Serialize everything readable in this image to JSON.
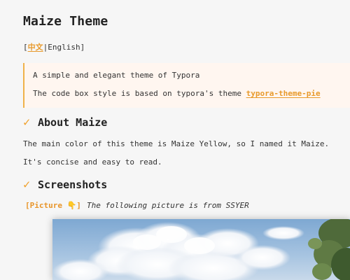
{
  "doc": {
    "title": "Maize Theme",
    "lang_open": "[",
    "lang_zh": "中文",
    "lang_sep": "|",
    "lang_en": "English",
    "lang_close": "]",
    "quote": {
      "line1": "A simple and elegant theme of Typora",
      "line2_prefix": "The code box style is based on typora's theme ",
      "line2_link": "typora-theme-pie"
    },
    "about": {
      "heading": "About Maize",
      "p1": "The main color of this theme is Maize Yellow, so I named it Maize.",
      "p2": "It's concise and easy to read."
    },
    "screenshots": {
      "heading": "Screenshots",
      "picture_tag": "[Picture 👇]",
      "caption": "The following picture is from SSYER"
    }
  },
  "colors": {
    "accent": "#e89a2c",
    "quote_bg": "#fff6f0",
    "quote_border": "#f0b24a",
    "page_bg": "#f6f6f6"
  },
  "icons": {
    "heading_marker": "check-icon",
    "picture_pointer": "pointing-down-emoji"
  }
}
